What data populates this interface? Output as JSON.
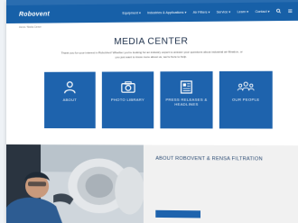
{
  "topbar": {
    "links": [
      "",
      "",
      "",
      "",
      "",
      ""
    ]
  },
  "nav": {
    "logo": "Robovent",
    "items": [
      "Equipment ▾",
      "Industries & Applications ▾",
      "Air Filters ▾",
      "Service ▾",
      "Learn ▾",
      "Contact ▾"
    ]
  },
  "breadcrumb": "Home / Media Center",
  "page_title": "MEDIA CENTER",
  "intro": "Thank you for your interest in RoboVent! Whether you're looking for an industry expert to answer your questions about industrial air filtration, or you just want to know more about us, we're here to help.",
  "cards": [
    {
      "icon": "id-card-icon",
      "title": "ABOUT",
      "desc": ""
    },
    {
      "icon": "camera-icon",
      "title": "PHOTO LIBRARY",
      "desc": ""
    },
    {
      "icon": "newspaper-icon",
      "title": "PRESS RELEASES & HEADLINES",
      "desc": ""
    },
    {
      "icon": "team-icon",
      "title": "OUR PEOPLE",
      "desc": ""
    }
  ],
  "about": {
    "title": "ABOUT ROBOVENT & RENSA FILTRATION",
    "text": "",
    "button_label": ""
  },
  "colors": {
    "brand_blue": "#1e63ad",
    "nav_blue": "#1760a8"
  }
}
